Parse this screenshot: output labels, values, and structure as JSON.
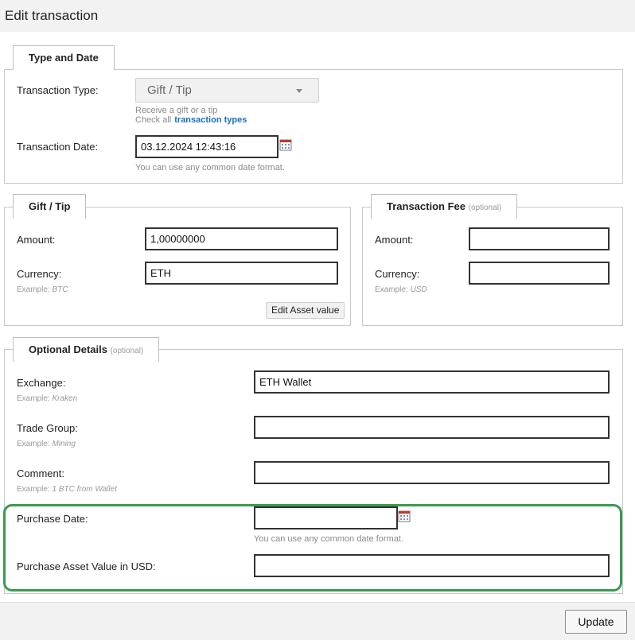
{
  "window": {
    "title": "Edit transaction"
  },
  "type_and_date": {
    "legend": "Type and Date",
    "type_label": "Transaction Type:",
    "type_value": "Gift / Tip",
    "type_hint": "Receive a gift or a tip",
    "check_all_text": "Check all",
    "types_link": "transaction types",
    "date_label": "Transaction Date:",
    "date_value": "03.12.2024 12:43:16",
    "date_hint": "You can use any common date format."
  },
  "gift_tip": {
    "legend": "Gift / Tip",
    "amount_label": "Amount:",
    "amount_value": "1,00000000",
    "currency_label": "Currency:",
    "currency_value": "ETH",
    "currency_example_prefix": "Example:",
    "currency_example": "BTC",
    "edit_asset_button": "Edit Asset value"
  },
  "fee": {
    "legend": "Transaction Fee",
    "legend_optional": "(optional)",
    "amount_label": "Amount:",
    "amount_value": "",
    "currency_label": "Currency:",
    "currency_value": "",
    "currency_example_prefix": "Example:",
    "currency_example": "USD"
  },
  "optional": {
    "legend": "Optional Details",
    "legend_optional": "(optional)",
    "exchange_label": "Exchange:",
    "exchange_value": "ETH Wallet",
    "exchange_example_prefix": "Example:",
    "exchange_example": "Kraken",
    "group_label": "Trade Group:",
    "group_value": "",
    "group_example_prefix": "Example:",
    "group_example": "Mining",
    "comment_label": "Comment:",
    "comment_value": "",
    "comment_example_prefix": "Example:",
    "comment_example": "1 BTC from Wallet",
    "purchase_date_label": "Purchase Date:",
    "purchase_date_value": "",
    "purchase_date_hint": "You can use any common date format.",
    "purchase_value_label": "Purchase Asset Value in USD:",
    "purchase_value_value": ""
  },
  "footer": {
    "update_button": "Update"
  },
  "colors": {
    "highlight": "#3a9a4e",
    "link": "#1a6fbf"
  }
}
